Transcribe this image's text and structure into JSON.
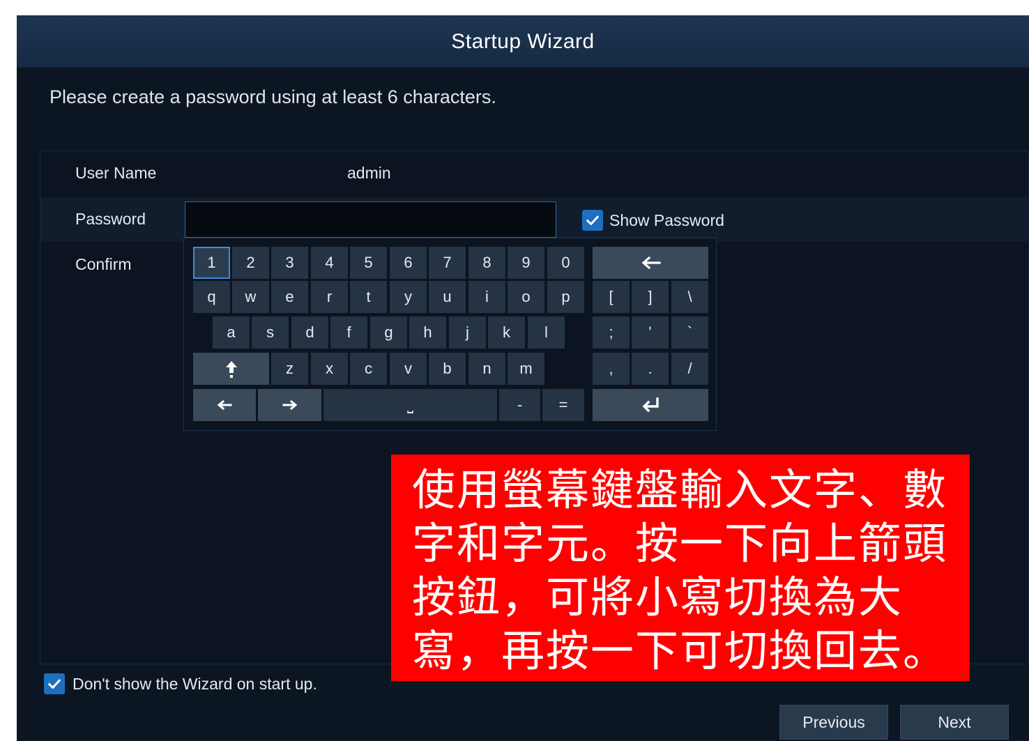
{
  "window": {
    "title": "Startup Wizard"
  },
  "instruction": "Please create a password using at least 6 characters.",
  "form": {
    "username_label": "User Name",
    "username_value": "admin",
    "password_label": "Password",
    "password_value": "",
    "confirm_label": "Confirm",
    "show_password_label": "Show Password",
    "show_password_checked": true
  },
  "keyboard": {
    "row1": [
      "1",
      "2",
      "3",
      "4",
      "5",
      "6",
      "7",
      "8",
      "9",
      "0"
    ],
    "row2": [
      "q",
      "w",
      "e",
      "r",
      "t",
      "y",
      "u",
      "i",
      "o",
      "p"
    ],
    "row3": [
      "a",
      "s",
      "d",
      "f",
      "g",
      "h",
      "j",
      "k",
      "l"
    ],
    "row4": [
      "z",
      "x",
      "c",
      "v",
      "b",
      "n",
      "m"
    ],
    "symbols_row2": [
      "[",
      "]",
      "\\"
    ],
    "symbols_row3": [
      ";",
      "'",
      "`"
    ],
    "symbols_row4": [
      ",",
      ".",
      "/"
    ],
    "minus": "-",
    "equals": "=",
    "space": "⎵",
    "backspace_icon": "backspace-arrow-icon",
    "shift_icon": "shift-up-arrow-icon",
    "left_icon": "cursor-left-icon",
    "right_icon": "cursor-right-icon",
    "enter_icon": "enter-icon",
    "selected_key": "1"
  },
  "footer": {
    "dont_show_label": "Don't show the Wizard on start up.",
    "dont_show_checked": true,
    "previous_label": "Previous",
    "next_label": "Next"
  },
  "overlay_note": "使用螢幕鍵盤輸入文字、數字和字元。按一下向上箭頭按鈕，可將小寫切換為大寫，再按一下可切換回去。",
  "colors": {
    "accent": "#1f6fc0",
    "overlay_bg": "#ff0000",
    "background": "#0c1522"
  }
}
